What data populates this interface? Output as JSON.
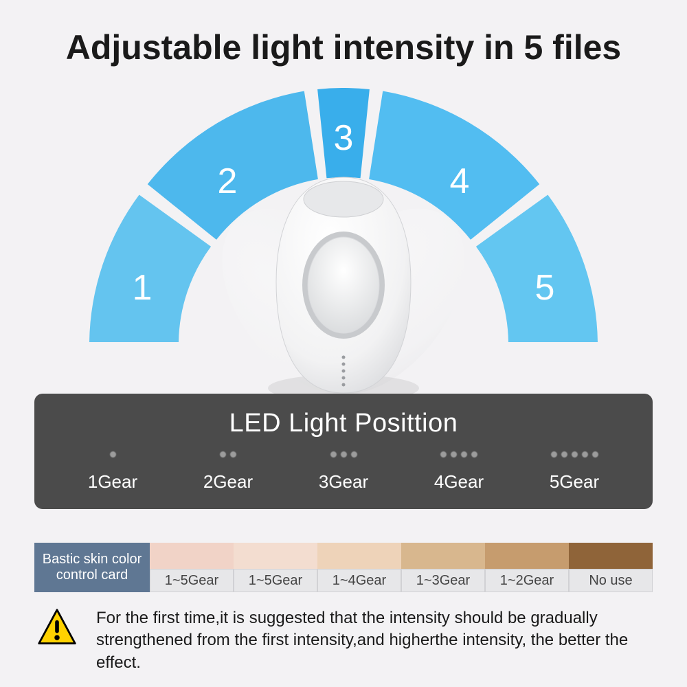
{
  "title": "Adjustable light intensity in 5 files",
  "arc": {
    "segments": [
      {
        "num": "1",
        "color": "#64c4ef"
      },
      {
        "num": "2",
        "color": "#4db8ed"
      },
      {
        "num": "3",
        "color": "#39aeeb"
      },
      {
        "num": "4",
        "color": "#52bdf1"
      },
      {
        "num": "5",
        "color": "#63c6f1"
      }
    ]
  },
  "led": {
    "title": "LED Light Posittion",
    "gears": [
      {
        "dots": 1,
        "label": "1Gear"
      },
      {
        "dots": 2,
        "label": "2Gear"
      },
      {
        "dots": 3,
        "label": "3Gear"
      },
      {
        "dots": 4,
        "label": "4Gear"
      },
      {
        "dots": 5,
        "label": "5Gear"
      }
    ]
  },
  "skin": {
    "head": "Bastic skin color control card",
    "cols": [
      {
        "color": "#f1d3c7",
        "label": "1~5Gear"
      },
      {
        "color": "#f3ddd0",
        "label": "1~5Gear"
      },
      {
        "color": "#eed3b9",
        "label": "1~4Gear"
      },
      {
        "color": "#d8b78e",
        "label": "1~3Gear"
      },
      {
        "color": "#c69c6e",
        "label": "1~2Gear"
      },
      {
        "color": "#8f6439",
        "label": "No use"
      }
    ]
  },
  "footer": {
    "text": "For the first time,it is suggested that the intensity should be gradually strengthened from the first intensity,and higherthe intensity, the better the effect."
  }
}
